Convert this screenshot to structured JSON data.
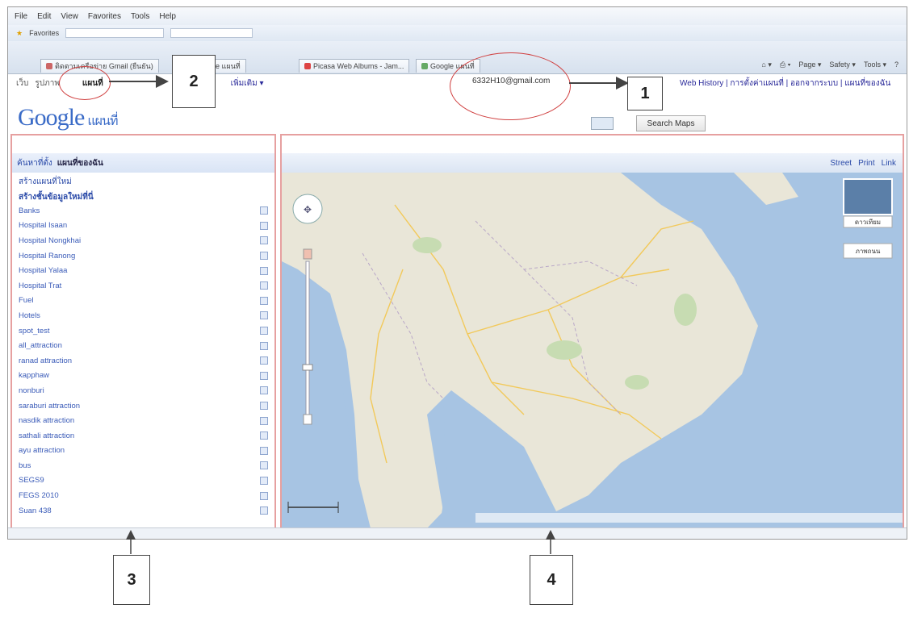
{
  "menubar": [
    "File",
    "Edit",
    "View",
    "Favorites",
    "Tools",
    "Help"
  ],
  "favorites_label": "Favorites",
  "tabs": [
    "ติดตามเครือข่าย Gmail (ยืนยัน)",
    "Google แผนที่",
    "Picasa Web Albums - Jam...",
    "Google แผนที่"
  ],
  "ie_tools": [
    "Page ▾",
    "Safety ▾",
    "Tools ▾"
  ],
  "google_bar": {
    "links": [
      "เว็บ",
      "รูปภาพ",
      "แผนที่",
      "เพิ่มเติม ▾"
    ],
    "active": "แผนที่"
  },
  "account_email": "6332H10@gmail.com",
  "right_links": "Web History | การตั้งค่าแผนที่ | ออกจากระบบ | แผนที่ของฉัน",
  "logo": {
    "brand": "Google",
    "product": "แผนที่"
  },
  "search_button": "Search Maps",
  "left_panel": {
    "header_tabs": [
      "ค้นหาที่ตั้ง",
      "แผนที่ของฉัน"
    ],
    "links": [
      "สร้างแผนที่ใหม่",
      "สร้างชั้นข้อมูลใหม่ที่นี่"
    ],
    "items": [
      "Banks",
      "Hospital Isaan",
      "Hospital Nongkhai",
      "Hospital Ranong",
      "Hospital Yalaa",
      "Hospital Trat",
      "Fuel",
      "Hotels",
      "spot_test",
      "all_attraction",
      "ranad attraction",
      "kapphaw",
      "nonburi",
      "saraburi attraction",
      "nasdik attraction",
      "sathali attraction",
      "ayu attraction",
      "bus",
      "SEGS9",
      "FEGS 2010",
      "Suan 438"
    ]
  },
  "map_panel": {
    "top_links": [
      "Street",
      "Print",
      "Link"
    ],
    "satellite_label": "ดาวเทียม",
    "terrain_label": "ภาพถนน"
  },
  "callouts": [
    "1",
    "2",
    "3",
    "4"
  ],
  "colors": {
    "annotation_red": "#d04040",
    "water": "#a7c4e3",
    "land": "#e9e6d8",
    "link_blue": "#2a4aa8"
  }
}
